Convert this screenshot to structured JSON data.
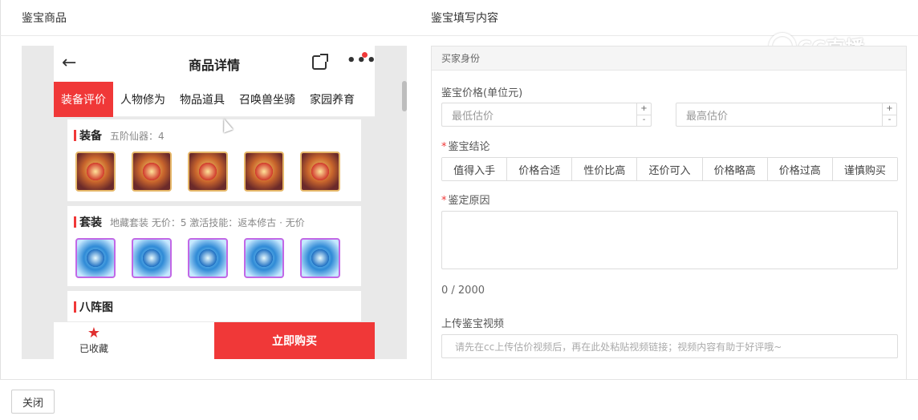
{
  "headers": {
    "left": "鉴宝商品",
    "right": "鉴宝填写内容"
  },
  "watermark": "CC直播",
  "phone": {
    "title": "商品详情",
    "icons": {
      "back": "arrow-left-icon",
      "share": "share-icon",
      "more": "more-dots-icon"
    },
    "tabs": [
      "装备评价",
      "人物修为",
      "物品道具",
      "召唤兽坐骑",
      "家园养育"
    ],
    "sections": {
      "equip": {
        "title": "装备",
        "sub": "五阶仙器：4"
      },
      "suit": {
        "title": "套装",
        "sub": "地藏套装  无价：5  激活技能：返本修古 · 无价"
      },
      "formation": {
        "title": "八阵图"
      }
    },
    "bottom": {
      "fav_label": "已收藏",
      "buy_label": "立即购买"
    }
  },
  "form": {
    "section": "买家身份",
    "price_label": "鉴宝价格(单位元)",
    "min_placeholder": "最低估价",
    "max_placeholder": "最高估价",
    "conclusion_label": "鉴宝结论",
    "conclusions": [
      "值得入手",
      "价格合适",
      "性价比高",
      "还价可入",
      "价格略高",
      "价格过高",
      "谨慎购买"
    ],
    "reason_label": "鉴定原因",
    "counter": "0 / 2000",
    "video_label": "上传鉴宝视频",
    "video_placeholder": "请先在cc上传估价视频后，再在此处粘贴视频链接；视频内容有助于好评哦~"
  },
  "footer": {
    "close_label": "关闭"
  }
}
